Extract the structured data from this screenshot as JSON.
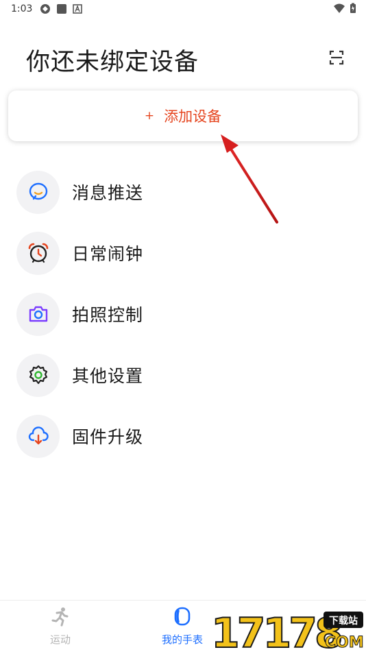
{
  "status_bar": {
    "time": "1:03"
  },
  "header": {
    "title": "你还未绑定设备"
  },
  "add_device": {
    "plus": "+",
    "label": "添加设备"
  },
  "menu": [
    {
      "label": "消息推送",
      "icon": "message-icon"
    },
    {
      "label": "日常闹钟",
      "icon": "alarm-clock-icon"
    },
    {
      "label": "拍照控制",
      "icon": "camera-icon"
    },
    {
      "label": "其他设置",
      "icon": "gear-icon"
    },
    {
      "label": "固件升级",
      "icon": "cloud-download-icon"
    }
  ],
  "bottom_nav": {
    "tabs": [
      {
        "label": "运动",
        "icon": "running-icon",
        "active": false
      },
      {
        "label": "我的手表",
        "icon": "watch-icon",
        "active": true
      }
    ]
  },
  "watermark": {
    "text_main": "17178",
    "text_tag": "下载站",
    "text_com": "COM"
  },
  "colors": {
    "accent_orange": "#e5451f",
    "active_blue": "#1e6fff",
    "arrow_red": "#d61f1f"
  }
}
